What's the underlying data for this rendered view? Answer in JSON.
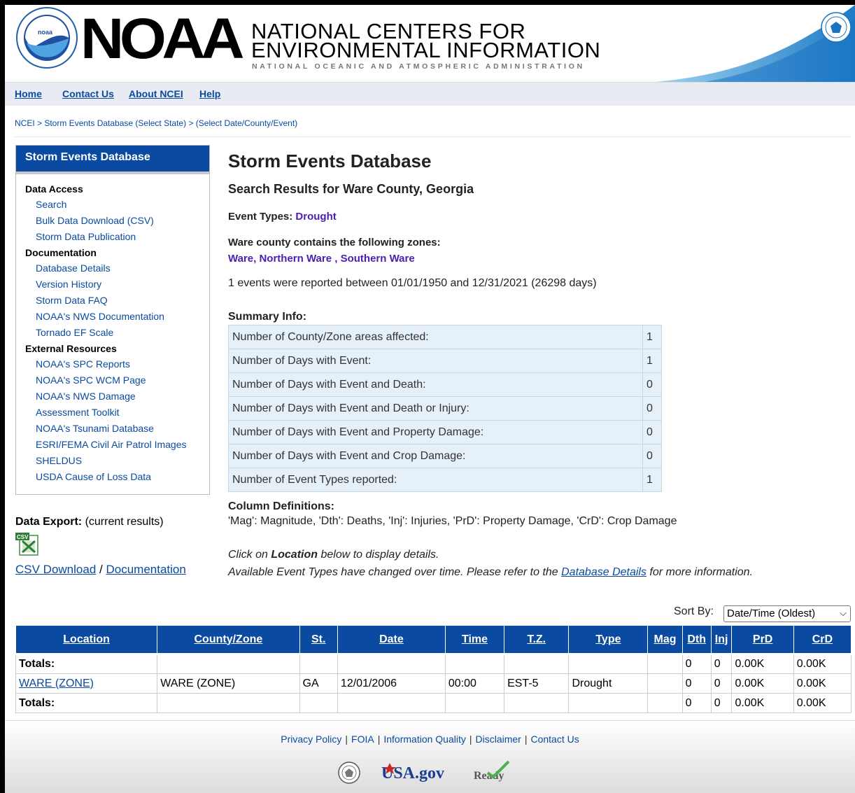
{
  "header": {
    "logo_noaa_word": "NOAA",
    "title_line1": "NATIONAL CENTERS FOR",
    "title_line2": "ENVIRONMENTAL INFORMATION",
    "subtitle": "NATIONAL OCEANIC AND ATMOSPHERIC ADMINISTRATION"
  },
  "nav": {
    "home": "Home",
    "contact": "Contact Us",
    "about": "About NCEI",
    "help": "Help"
  },
  "breadcrumb": "NCEI > Storm Events Database (Select State) > (Select Date/County/Event)",
  "sidebar": {
    "title": "Storm Events Database",
    "sections": [
      {
        "title": "Data Access",
        "links": [
          "Search",
          "Bulk Data Download (CSV)",
          "Storm Data Publication"
        ]
      },
      {
        "title": "Documentation",
        "links": [
          "Database Details",
          "Version History",
          "Storm Data FAQ",
          "NOAA's NWS Documentation",
          "Tornado EF Scale"
        ]
      },
      {
        "title": "External Resources",
        "links": [
          "NOAA's SPC Reports",
          "NOAA's SPC WCM Page",
          "NOAA's NWS Damage",
          "Assessment Toolkit",
          "NOAA's Tsunami Database",
          "ESRI/FEMA Civil Air Patrol Images",
          "SHELDUS",
          "USDA Cause of Loss Data"
        ]
      }
    ]
  },
  "export": {
    "label": "Data Export:",
    "label_suffix": "(current results)",
    "csv_link": "CSV Download",
    "slash": "/",
    "doc_link": "Documentation",
    "icon_text": "CSV"
  },
  "main": {
    "title": "Storm Events Database",
    "subtitle": "Search Results for Ware County, Georgia",
    "event_types_label": "Event Types:",
    "event_types_value": "Drought",
    "zones_label": "Ware county contains the following zones:",
    "zones_value": "Ware, Northern Ware , Southern Ware",
    "events_text": "1 events were reported between 01/01/1950 and 12/31/2021 (26298 days)",
    "summary_title": "Summary Info:",
    "summary": [
      {
        "label": "Number of County/Zone areas affected:",
        "value": "1"
      },
      {
        "label": "Number of Days with Event:",
        "value": "1"
      },
      {
        "label": "Number of Days with Event and Death:",
        "value": "0"
      },
      {
        "label": "Number of Days with Event and Death or Injury:",
        "value": "0"
      },
      {
        "label": "Number of Days with Event and Property Damage:",
        "value": "0"
      },
      {
        "label": "Number of Days with Event and Crop Damage:",
        "value": "0"
      },
      {
        "label": "Number of Event Types reported:",
        "value": "1"
      }
    ],
    "coldef_title": "Column Definitions:",
    "coldef_text": "'Mag': Magnitude, 'Dth': Deaths, 'Inj': Injuries, 'PrD': Property Damage, 'CrD': Crop Damage",
    "click_pre": "Click on ",
    "click_bold": "Location",
    "click_post": " below to display details.",
    "available_pre": "Available Event Types have changed over time. Please refer to the ",
    "available_link": "Database Details",
    "available_post": " for more information."
  },
  "sort": {
    "label": "Sort By:",
    "selected": "Date/Time (Oldest)"
  },
  "results": {
    "headers": [
      "Location",
      "County/Zone",
      "St.",
      "Date",
      "Time",
      "T.Z.",
      "Type",
      "Mag",
      "Dth",
      "Inj",
      "PrD",
      "CrD"
    ],
    "totals_top": [
      "Totals:",
      "",
      "",
      "",
      "",
      "",
      "",
      "",
      "0",
      "0",
      "0.00K",
      "0.00K"
    ],
    "row": [
      "WARE (ZONE)",
      "WARE (ZONE)",
      "GA",
      "12/01/2006",
      "00:00",
      "EST-5",
      "Drought",
      "",
      "0",
      "0",
      "0.00K",
      "0.00K"
    ],
    "totals_bottom": [
      "Totals:",
      "",
      "",
      "",
      "",
      "",
      "",
      "",
      "0",
      "0",
      "0.00K",
      "0.00K"
    ]
  },
  "footer": {
    "links": [
      "Privacy Policy",
      "FOIA",
      "Information Quality",
      "Disclaimer",
      "Contact Us"
    ],
    "usa_gov": "USA.gov",
    "ready": "Ready"
  },
  "colors": {
    "brand_blue": "#0a4aa0",
    "link_purple": "#4a1fb0",
    "summary_bg": "#e6f0f8"
  }
}
